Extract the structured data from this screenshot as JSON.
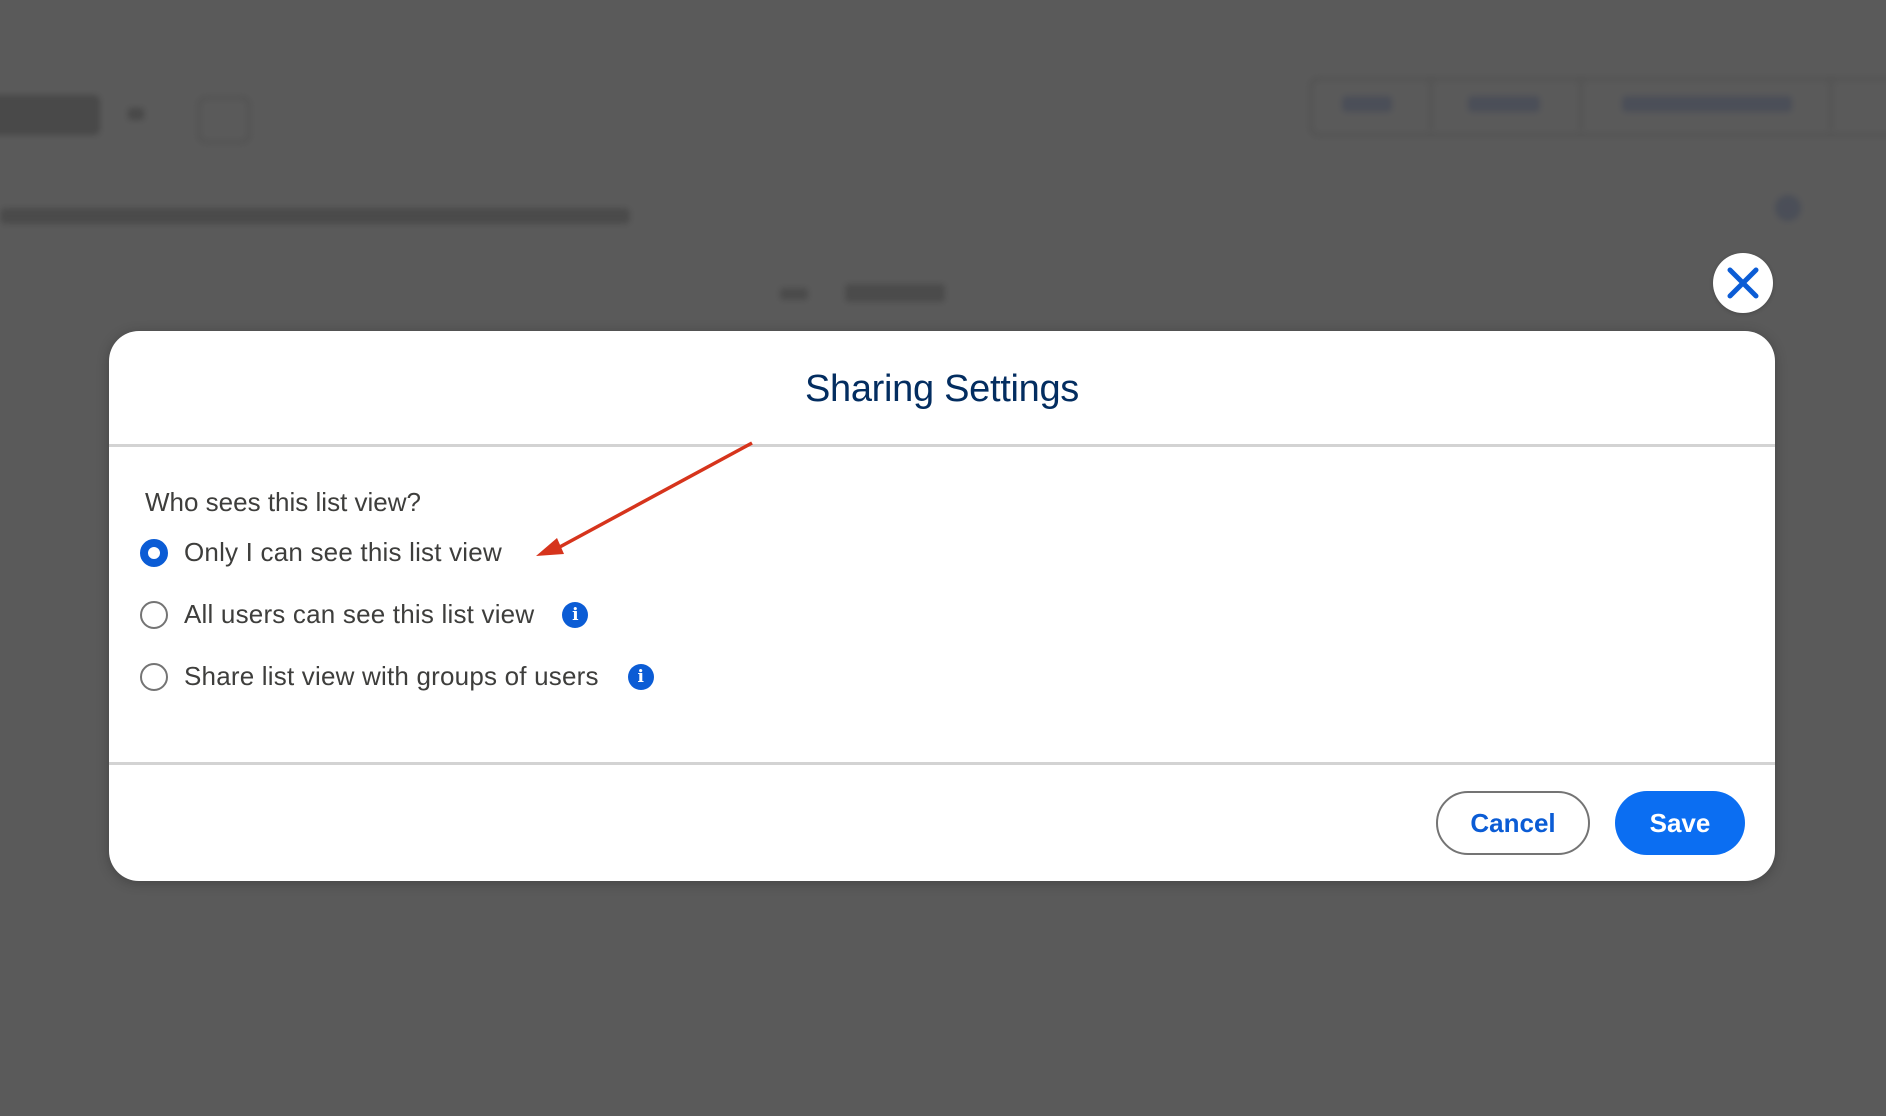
{
  "modal": {
    "title": "Sharing Settings",
    "question": "Who sees this list view?",
    "options": [
      {
        "label": "Only I can see this list view",
        "checked": true,
        "has_info": false
      },
      {
        "label": "All users can see this list view",
        "checked": false,
        "has_info": true
      },
      {
        "label": "Share list view with groups of users",
        "checked": false,
        "has_info": true
      }
    ],
    "cancel_label": "Cancel",
    "save_label": "Save"
  },
  "icons": {
    "close": "close-icon",
    "info": "info-icon",
    "annotation": "arrow-annotation"
  },
  "colors": {
    "overlay": "#5a5a5a",
    "title": "#032d60",
    "brand_blue": "#0b5cd5",
    "save_blue": "#0b6ef2",
    "annotation_red": "#d6341c"
  }
}
